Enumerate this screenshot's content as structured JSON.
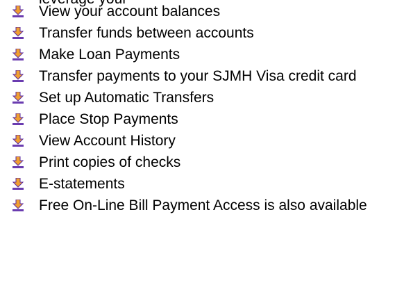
{
  "top_clipped_text": "leverage your",
  "bullet_icon": "down-arrow-with-base-icon",
  "colors": {
    "arrow_fill": "#f0a030",
    "arrow_dark": "#5a28a0",
    "base_bar": "#6a3cb0"
  },
  "features": [
    {
      "label": "View your account balances"
    },
    {
      "label": "Transfer funds between accounts"
    },
    {
      "label": "Make Loan Payments"
    },
    {
      "label": "Transfer payments to your SJMH Visa credit card"
    },
    {
      "label": "Set up Automatic Transfers"
    },
    {
      "label": "Place Stop Payments"
    },
    {
      "label": "View Account History"
    },
    {
      "label": "Print copies of checks"
    },
    {
      "label": "E-statements"
    },
    {
      "label": "Free On-Line Bill Payment Access is also available"
    }
  ]
}
